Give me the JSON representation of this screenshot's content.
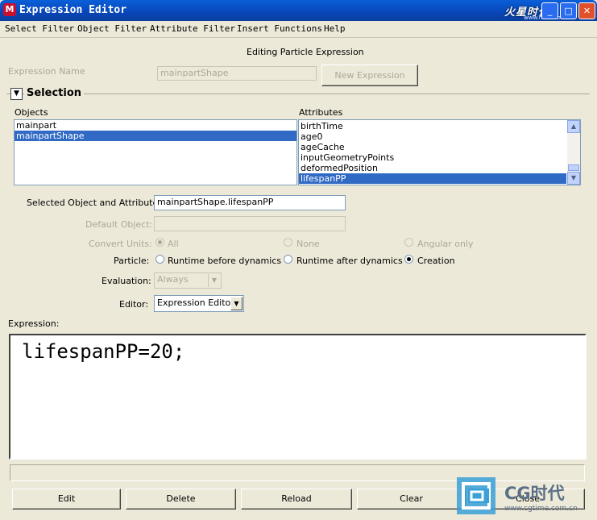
{
  "window": {
    "title": "Expression Editor",
    "minimize": "_",
    "maximize": "□",
    "close": "✕",
    "watermark_top": "火星时代",
    "watermark_top_sub": "www.hxsd.com"
  },
  "menu": [
    "Select Filter",
    "Object Filter",
    "Attribute Filter",
    "Insert Functions",
    "Help"
  ],
  "heading": "Editing Particle Expression",
  "expression_name": {
    "label": "Expression Name",
    "value": "mainpartShape"
  },
  "new_expression_button": "New Expression",
  "selection": {
    "title": "Selection",
    "objects_label": "Objects",
    "objects": [
      "mainpart",
      "mainpartShape"
    ],
    "objects_selected": "mainpartShape",
    "attributes_label": "Attributes",
    "attributes": [
      "birthTime",
      "age0",
      "ageCache",
      "inputGeometryPoints",
      "deformedPosition",
      "lifespanPP"
    ],
    "attributes_selected": "lifespanPP"
  },
  "selected_object_attr": {
    "label": "Selected Object and Attribute:",
    "value": "mainpartShape.lifespanPP"
  },
  "default_object": {
    "label": "Default Object:",
    "value": ""
  },
  "convert_units": {
    "label": "Convert Units:",
    "options": [
      "All",
      "None",
      "Angular only"
    ],
    "selected": "All"
  },
  "particle": {
    "label": "Particle:",
    "options": [
      "Runtime before dynamics",
      "Runtime after dynamics",
      "Creation"
    ],
    "selected": "Creation"
  },
  "evaluation": {
    "label": "Evaluation:",
    "value": "Always"
  },
  "editor": {
    "label": "Editor:",
    "value": "Expression Editor"
  },
  "expression": {
    "label": "Expression:",
    "text": "lifespanPP=20;"
  },
  "buttons": {
    "edit": "Edit",
    "delete": "Delete",
    "reload": "Reload",
    "clear": "Clear",
    "close": "Close"
  },
  "watermark_bottom": {
    "brand": "CG时代",
    "url": "www.cgtime.com.cn"
  },
  "colors": {
    "selection": "#316ac5",
    "titlebar": "#0a5fd8",
    "panel": "#ece9d8"
  }
}
